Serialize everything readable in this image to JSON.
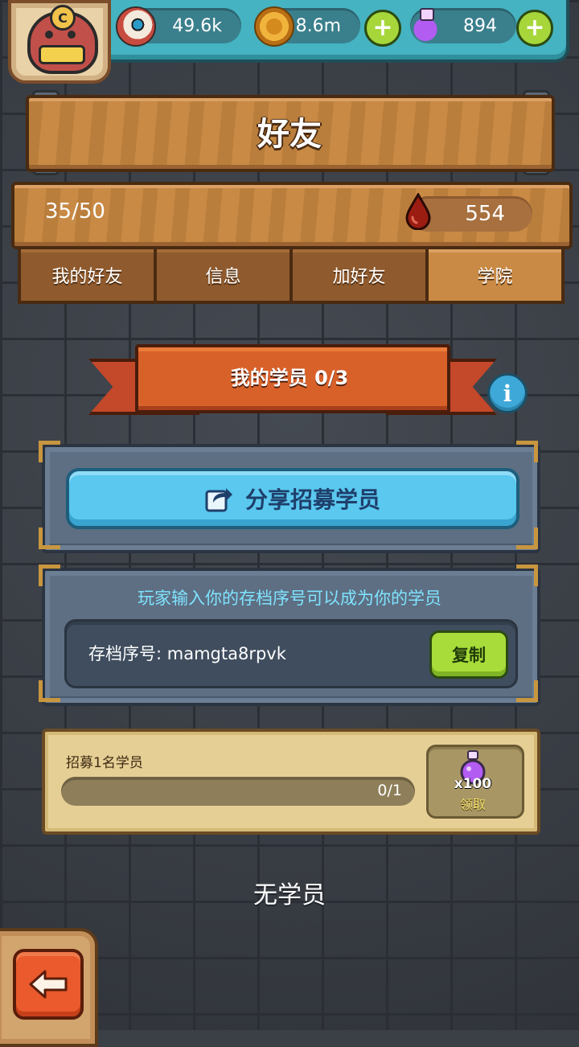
{
  "header": {
    "resources": [
      {
        "icon": "eyeball-icon",
        "value": "49.6k"
      },
      {
        "icon": "coin-icon",
        "value": "8.6m"
      },
      {
        "icon": "purple-potion-icon",
        "value": "894"
      }
    ],
    "plus_symbol": "+",
    "avatar_badge": "C"
  },
  "title": "好友",
  "stats": {
    "friend_count": "35/50",
    "blood_value": "554"
  },
  "tabs": [
    {
      "label": "我的好友",
      "active": false
    },
    {
      "label": "信息",
      "active": false
    },
    {
      "label": "加好友",
      "active": false
    },
    {
      "label": "学院",
      "active": true
    }
  ],
  "academy": {
    "ribbon_title": "我的学员 0/3",
    "info_symbol": "i",
    "share_button": "分享招募学员",
    "hint": "玩家输入你的存档序号可以成为你的学员",
    "serial_label": "存档序号: mamgta8rpvk",
    "copy_button": "复制",
    "task": {
      "label": "招募1名学员",
      "progress_text": "0/1",
      "progress_value": 0,
      "reward_qty": "x100",
      "claim_label": "领取"
    },
    "empty_text": "无学员"
  },
  "colors": {
    "accent_blue": "#5ac8ef",
    "accent_green": "#a8dc3a",
    "ribbon_orange": "#d8612a",
    "wood": "#c98a45"
  }
}
